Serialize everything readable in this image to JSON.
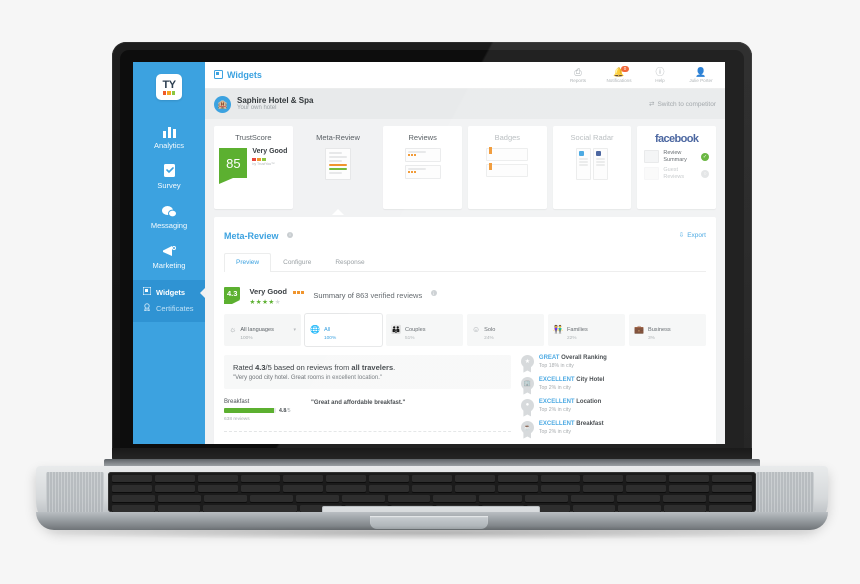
{
  "brand": {
    "logo_text": "TY",
    "logo_squares": [
      "#f05a28",
      "#f5a623",
      "#8cc63f",
      "#5cb030"
    ],
    "accent": "#3ca2e0",
    "green": "#5cb030",
    "orange": "#f0952e"
  },
  "sidebar": {
    "items": [
      {
        "label": "Analytics",
        "icon": "bar-chart-icon"
      },
      {
        "label": "Survey",
        "icon": "clipboard-check-icon"
      },
      {
        "label": "Messaging",
        "icon": "chat-bubbles-icon"
      },
      {
        "label": "Marketing",
        "icon": "megaphone-icon"
      }
    ],
    "sub_items": [
      {
        "label": "Widgets",
        "icon": "widgets-icon",
        "active": true
      },
      {
        "label": "Certificates",
        "icon": "certificate-icon",
        "active": false
      }
    ]
  },
  "topbar": {
    "breadcrumb": "Widgets",
    "breadcrumb_icon": "widgets-icon",
    "actions": [
      {
        "label": "Reports",
        "icon": "reports-icon",
        "badge": ""
      },
      {
        "label": "Notifications",
        "icon": "bell-icon",
        "badge": "0"
      },
      {
        "label": "Help",
        "icon": "help-icon",
        "badge": ""
      },
      {
        "label": "Julie Porter",
        "icon": "user-icon",
        "badge": ""
      }
    ]
  },
  "hotel": {
    "name": "Saphire Hotel & Spa",
    "subtitle": "Your own hotel",
    "avatar_icon": "hotel-icon",
    "switch_label": "Switch to competitor",
    "switch_icon": "shuffle-icon"
  },
  "widget_cards": [
    {
      "title": "TrustScore",
      "selected": false,
      "dim": false,
      "kind": "trustscore"
    },
    {
      "title": "Meta-Review",
      "selected": true,
      "dim": false,
      "kind": "doc"
    },
    {
      "title": "Reviews",
      "selected": false,
      "dim": false,
      "kind": "reviews"
    },
    {
      "title": "Badges",
      "selected": false,
      "dim": true,
      "kind": "badges"
    },
    {
      "title": "Social Radar",
      "selected": false,
      "dim": true,
      "kind": "radar"
    },
    {
      "title": "facebook",
      "selected": false,
      "dim": false,
      "kind": "facebook"
    }
  ],
  "trustscore_card": {
    "score": "85",
    "label": "Very Good",
    "by": "by TrustYou™"
  },
  "facebook_card": {
    "logo": "facebook",
    "rows": [
      {
        "label": "Review Summary",
        "enabled": true,
        "check_icon": "check-circle-icon"
      },
      {
        "label": "Guest Reviews",
        "enabled": false,
        "check_icon": "circle-icon"
      }
    ]
  },
  "panel": {
    "title": "Meta-Review",
    "info_icon": "info-icon",
    "export_label": "Export",
    "export_icon": "export-icon",
    "tabs": [
      {
        "label": "Preview",
        "active": true
      },
      {
        "label": "Configure",
        "active": false
      },
      {
        "label": "Response",
        "active": false
      }
    ]
  },
  "summary": {
    "score": "4.3",
    "label": "Very Good",
    "stars_filled": 4,
    "stars_total": 5,
    "text": "Summary of 863 verified reviews",
    "info_icon": "info-icon"
  },
  "segments": [
    {
      "label": "All languages",
      "percent": "100%",
      "icon": "languages-icon",
      "active": false,
      "caret": true
    },
    {
      "label": "All",
      "percent": "100%",
      "icon": "globe-icon",
      "active": true,
      "caret": false
    },
    {
      "label": "Couples",
      "percent": "51%",
      "icon": "couples-icon",
      "active": false,
      "caret": false
    },
    {
      "label": "Solo",
      "percent": "24%",
      "icon": "solo-icon",
      "active": false,
      "caret": false
    },
    {
      "label": "Families",
      "percent": "22%",
      "icon": "families-icon",
      "active": false,
      "caret": false
    },
    {
      "label": "Business",
      "percent": "3%",
      "icon": "business-icon",
      "active": false,
      "caret": false
    }
  ],
  "rated": {
    "line1_pre": "Rated ",
    "line1_score": "4.3",
    "line1_mid": "/5 based on reviews from ",
    "line1_who": "all travelers",
    "line1_end": ".",
    "quote": "\"Very good city hotel. Great rooms in excellent location.\""
  },
  "categories": [
    {
      "name": "Breakfast",
      "value": "4.8",
      "scale": "/5",
      "fill_percent": 96,
      "reviews": "638 reviews",
      "quote": "\"Great and affordable breakfast.\""
    }
  ],
  "badges": [
    {
      "quality": "GREAT",
      "name": "Overall Ranking",
      "sub": "Top 18% in city",
      "icon": "ribbon-star-icon"
    },
    {
      "quality": "EXCELLENT",
      "name": "City Hotel",
      "sub": "Top 2% in city",
      "icon": "ribbon-building-icon"
    },
    {
      "quality": "EXCELLENT",
      "name": "Location",
      "sub": "Top 2% in city",
      "icon": "ribbon-pin-icon"
    },
    {
      "quality": "EXCELLENT",
      "name": "Breakfast",
      "sub": "Top 2% in city",
      "icon": "ribbon-cup-icon"
    }
  ]
}
